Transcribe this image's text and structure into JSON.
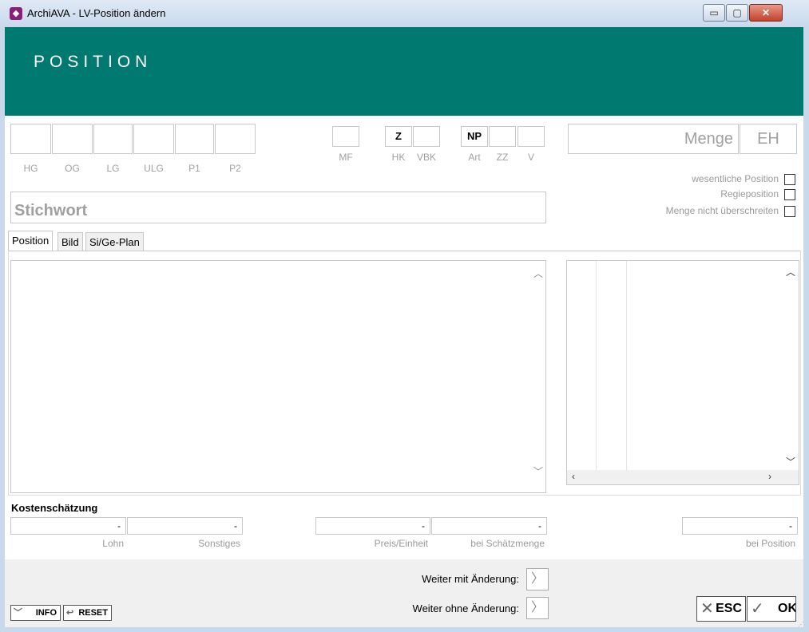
{
  "window": {
    "title": "ArchiAVA - LV-Position ändern",
    "app_icon": "archiava-logo-icon",
    "min": "▭",
    "max": "▢",
    "close": "✕"
  },
  "header": {
    "title": "POSITION",
    "color": "#007a70"
  },
  "hierarchy": {
    "labels": [
      "HG",
      "OG",
      "LG",
      "ULG",
      "P1",
      "P2"
    ]
  },
  "mf": {
    "label": "MF"
  },
  "hk": {
    "value": "Z",
    "label": "HK"
  },
  "vbk": {
    "label": "VBK"
  },
  "art": {
    "value": "NP",
    "label": "Art"
  },
  "zz": {
    "label": "ZZ"
  },
  "v": {
    "label": "V"
  },
  "menge": {
    "placeholder": "Menge",
    "eh": "EH"
  },
  "options": {
    "wesentlich": "wesentliche Position",
    "regie": "Regieposition",
    "nicht_ueberschreiten": "Menge nicht überschreiten"
  },
  "stichwort": {
    "placeholder": "Stichwort"
  },
  "tabs": [
    "Position",
    "Bild",
    "Si/Ge-Plan"
  ],
  "cost": {
    "title": "Kostenschätzung",
    "lohn": {
      "value": "-",
      "label": "Lohn"
    },
    "sonstiges": {
      "value": "-",
      "label": "Sonstiges"
    },
    "preis_einheit": {
      "value": "-",
      "label": "Preis/Einheit"
    },
    "schaetzmenge": {
      "value": "-",
      "label": "bei Schätzmenge"
    },
    "position": {
      "value": "-",
      "label": "bei Position"
    }
  },
  "nav": {
    "weiter_mit": "Weiter mit Änderung:",
    "weiter_ohne": "Weiter ohne Änderung:",
    "arrow": "〉"
  },
  "buttons": {
    "info": "INFO",
    "reset": "RESET",
    "esc": "ESC",
    "ok": "OK"
  }
}
